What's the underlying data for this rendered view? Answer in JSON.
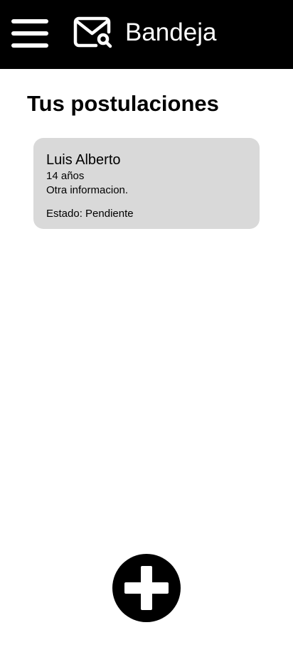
{
  "header": {
    "menu_icon": "hamburger-menu-icon",
    "mail_icon": "mail-search-icon",
    "title": "Bandeja",
    "background": "#000000"
  },
  "main": {
    "section_title": "Tus postulaciones",
    "cards": [
      {
        "name": "Luis Alberto",
        "age": "14 años",
        "info": "Otra informacion.",
        "status": "Estado: Pendiente",
        "background": "#d9d9d9"
      }
    ]
  },
  "fab": {
    "icon": "plus-icon"
  }
}
